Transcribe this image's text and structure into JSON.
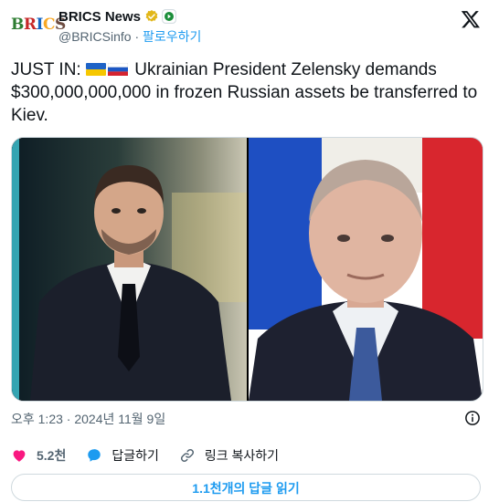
{
  "header": {
    "avatar_text": "BRICS",
    "display_name": "BRICS News",
    "handle": "@BRICSinfo",
    "separator": " · ",
    "follow_label": "팔로우하기",
    "logo_icon": "x-logo-icon"
  },
  "tweet": {
    "prefix": "JUST IN: ",
    "flags": [
      "ukraine-flag",
      "russia-flag"
    ],
    "text": " Ukrainian President Zelensky demands $300,000,000,000 in frozen Russian assets be transferred to Kiev."
  },
  "media": {
    "left_image": "zelensky-photo",
    "right_image": "putin-photo"
  },
  "meta": {
    "timestamp": "오후 1:23 · 2024년 11월 9일",
    "info_icon": "info-icon"
  },
  "actions": {
    "like_count": "5.2천",
    "reply_label": "답글하기",
    "copy_link_label": "링크 복사하기"
  },
  "read_replies_label": "1.1천개의 답글 읽기",
  "colors": {
    "accent": "#1d9bf0",
    "like": "#f91880",
    "verified": "#e2b719",
    "text": "#0f1419",
    "secondary": "#536471"
  }
}
